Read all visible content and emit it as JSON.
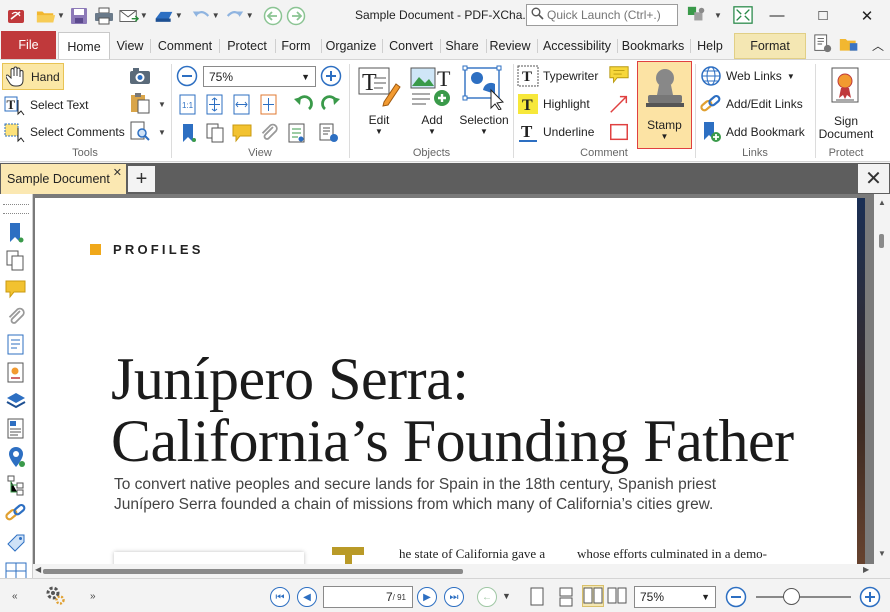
{
  "window": {
    "title": "Sample Document - PDF-XCha...",
    "quick_launch_placeholder": "Quick Launch (Ctrl+.)",
    "minimize": "—",
    "maximize": "□",
    "close": "✕"
  },
  "menu": {
    "tabs": [
      {
        "label": "File"
      },
      {
        "label": "Home"
      },
      {
        "label": "View"
      },
      {
        "label": "Comment"
      },
      {
        "label": "Protect"
      },
      {
        "label": "Form"
      },
      {
        "label": "Organize"
      },
      {
        "label": "Convert"
      },
      {
        "label": "Share"
      },
      {
        "label": "Review"
      },
      {
        "label": "Accessibility"
      },
      {
        "label": "Bookmarks"
      },
      {
        "label": "Help"
      },
      {
        "label": "Format"
      }
    ]
  },
  "ribbon": {
    "tools": {
      "label": "Tools",
      "hand": "Hand",
      "select_text": "Select Text",
      "select_comments": "Select Comments"
    },
    "view": {
      "label": "View",
      "zoom_value": "75%"
    },
    "objects": {
      "label": "Objects",
      "edit": "Edit",
      "add": "Add",
      "selection": "Selection"
    },
    "comment": {
      "label": "Comment",
      "typewriter": "Typewriter",
      "highlight": "Highlight",
      "underline": "Underline",
      "stamp": "Stamp"
    },
    "links": {
      "label": "Links",
      "web_links": "Web Links",
      "add_edit_links": "Add/Edit Links",
      "add_bookmark": "Add Bookmark"
    },
    "protect": {
      "label": "Protect",
      "sign_line1": "Sign",
      "sign_line2": "Document"
    }
  },
  "doc_tab": {
    "name": "Sample Document",
    "close": "✕",
    "new_tab": "+",
    "close_all": "✕"
  },
  "page": {
    "section": "PROFILES",
    "headline_line1": "Junípero Serra:",
    "headline_line2": "California’s Founding Father",
    "deck_line1": "To convert native peoples and secure lands for Spain in the 18th century, Spanish priest",
    "deck_line2": "Junípero Serra founded a chain of missions from which many of California’s cities grew.",
    "body_col1": "he state of California gave a",
    "body_col2": "whose efforts culminated in a demo-"
  },
  "status": {
    "page_current": "7",
    "page_total": "/ 91",
    "zoom_value": "75%"
  },
  "colors": {
    "file_tab": "#c0393b",
    "accent_yellow": "#fbe8b2",
    "nav_blue": "#2d6fc2",
    "dropcap_gold": "#b99a28",
    "section_square": "#f0a81a"
  }
}
